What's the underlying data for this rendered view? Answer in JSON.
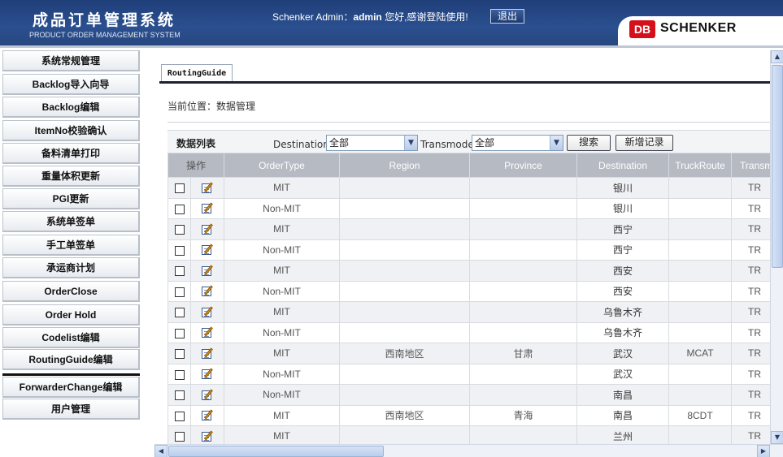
{
  "header": {
    "title": "成品订单管理系统",
    "subtitle": "PRODUCT ORDER MANAGEMENT SYSTEM",
    "greeting_prefix": "Schenker Admin：",
    "username": "admin",
    "greeting_suffix": " 您好,感谢登陆使用!",
    "logout_label": "退出",
    "logo_db": "DB",
    "logo_text": "SCHENKER",
    "brand_color": "#d6101b"
  },
  "sidebar": {
    "items": [
      {
        "label": "系统常规管理"
      },
      {
        "label": "Backlog导入向导"
      },
      {
        "label": "Backlog编辑"
      },
      {
        "label": "ItemNo校验确认"
      },
      {
        "label": "备料清单打印"
      },
      {
        "label": "重量体积更新"
      },
      {
        "label": "PGI更新"
      },
      {
        "label": "系统单签单"
      },
      {
        "label": "手工单签单"
      },
      {
        "label": "承运商计划"
      },
      {
        "label": "OrderClose"
      },
      {
        "label": "Order Hold"
      },
      {
        "label": "Codelist编辑"
      },
      {
        "label": "RoutingGuide编辑"
      },
      {
        "label": "ForwarderChange编辑"
      },
      {
        "label": "用户管理"
      }
    ]
  },
  "main": {
    "tab_label": "RoutingGuide",
    "breadcrumb": "当前位置：数据管理",
    "toolbar": {
      "list_label": "数据列表",
      "destination_label": "Destination:",
      "destination_value": "全部",
      "transmode_label": "Transmode",
      "transmode_value": "全部",
      "search_label": "搜索",
      "add_label": "新增记录"
    },
    "table": {
      "headers": [
        "操作",
        "OrderType",
        "Region",
        "Province",
        "Destination",
        "TruckRoute",
        "Transmode"
      ],
      "rows": [
        {
          "order_type": "MIT",
          "region": "",
          "province": "",
          "destination": "银川",
          "truck_route": "",
          "transmode": "TR"
        },
        {
          "order_type": "Non-MIT",
          "region": "",
          "province": "",
          "destination": "银川",
          "truck_route": "",
          "transmode": "TR"
        },
        {
          "order_type": "MIT",
          "region": "",
          "province": "",
          "destination": "西宁",
          "truck_route": "",
          "transmode": "TR"
        },
        {
          "order_type": "Non-MIT",
          "region": "",
          "province": "",
          "destination": "西宁",
          "truck_route": "",
          "transmode": "TR"
        },
        {
          "order_type": "MIT",
          "region": "",
          "province": "",
          "destination": "西安",
          "truck_route": "",
          "transmode": "TR"
        },
        {
          "order_type": "Non-MIT",
          "region": "",
          "province": "",
          "destination": "西安",
          "truck_route": "",
          "transmode": "TR"
        },
        {
          "order_type": "MIT",
          "region": "",
          "province": "",
          "destination": "乌鲁木齐",
          "truck_route": "",
          "transmode": "TR"
        },
        {
          "order_type": "Non-MIT",
          "region": "",
          "province": "",
          "destination": "乌鲁木齐",
          "truck_route": "",
          "transmode": "TR"
        },
        {
          "order_type": "MIT",
          "region": "西南地区",
          "province": "甘肃",
          "destination": "武汉",
          "truck_route": "MCAT",
          "transmode": "TR"
        },
        {
          "order_type": "Non-MIT",
          "region": "",
          "province": "",
          "destination": "武汉",
          "truck_route": "",
          "transmode": "TR"
        },
        {
          "order_type": "Non-MIT",
          "region": "",
          "province": "",
          "destination": "南昌",
          "truck_route": "",
          "transmode": "TR"
        },
        {
          "order_type": "MIT",
          "region": "西南地区",
          "province": "青海",
          "destination": "南昌",
          "truck_route": "8CDT",
          "transmode": "TR"
        },
        {
          "order_type": "MIT",
          "region": "",
          "province": "",
          "destination": "兰州",
          "truck_route": "",
          "transmode": "TR"
        }
      ]
    }
  }
}
